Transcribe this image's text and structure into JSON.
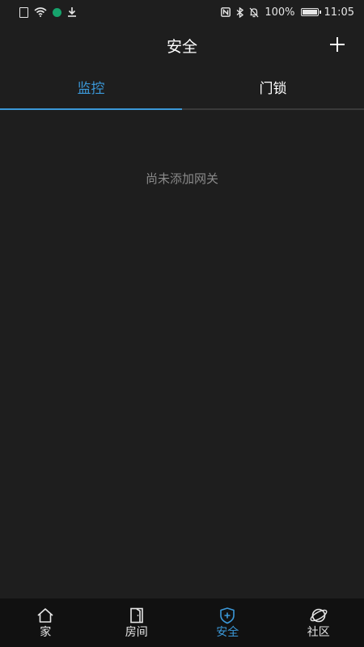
{
  "status_bar": {
    "battery": "100%",
    "time": "11:05",
    "battery_level": 1.0,
    "icons_left": [
      "sim-icon",
      "wifi-icon",
      "app-dot-icon",
      "download-icon"
    ],
    "icons_right": [
      "nfc-icon",
      "bluetooth-icon",
      "mute-icon",
      "battery-icon"
    ]
  },
  "header": {
    "title": "安全",
    "add_icon": "plus-icon"
  },
  "tabs": [
    {
      "label": "监控",
      "active": true
    },
    {
      "label": "门锁",
      "active": false
    }
  ],
  "main": {
    "empty_message": "尚未添加网关"
  },
  "bottom_nav": [
    {
      "label": "家",
      "icon": "home-icon",
      "active": false
    },
    {
      "label": "房间",
      "icon": "door-icon",
      "active": false
    },
    {
      "label": "安全",
      "icon": "shield-icon",
      "active": true
    },
    {
      "label": "社区",
      "icon": "planet-icon",
      "active": false
    }
  ],
  "colors": {
    "background": "#1e1e1e",
    "accent": "#3b98d8",
    "nav_background": "#111111",
    "muted_text": "#8a8a8a"
  }
}
